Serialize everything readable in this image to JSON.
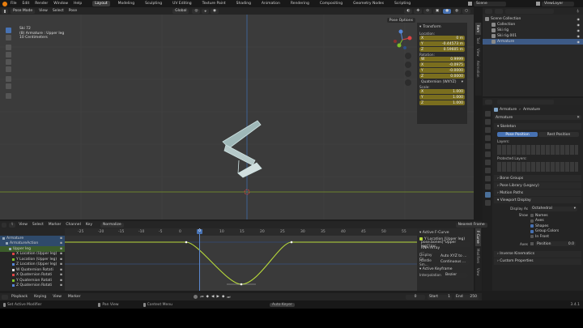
{
  "topbar": {
    "menus": [
      "File",
      "Edit",
      "Render",
      "Window",
      "Help"
    ],
    "tabs": [
      "Layout",
      "Modeling",
      "Sculpting",
      "UV Editing",
      "Texture Paint",
      "Shading",
      "Animation",
      "Rendering",
      "Compositing",
      "Geometry Nodes",
      "Scripting"
    ],
    "active_tab": "Layout",
    "scene": "Scene",
    "view_layer": "ViewLayer"
  },
  "viewport": {
    "mode": "Pose Mode",
    "menus": [
      "View",
      "Select",
      "Pose"
    ],
    "transform_orientation": "Global",
    "info_line1": "Ski 72",
    "info_line2": "(8) Armature : Upper leg",
    "info_line3": "10 Centimeters",
    "options_label": "Pose Options"
  },
  "npanel": {
    "title": "Transform",
    "location_label": "Location:",
    "location": [
      [
        "X",
        "0 m"
      ],
      [
        "Y",
        "-0.44573 m"
      ],
      [
        "Z",
        "0.59605 m"
      ]
    ],
    "rotation_label": "Rotation:",
    "rotation": [
      [
        "W",
        "0.9999"
      ],
      [
        "X",
        "-0.0975"
      ],
      [
        "Y",
        "-0.0000"
      ],
      [
        "Z",
        "0.0000"
      ]
    ],
    "rotation_mode": "Quaternion (WXYZ)",
    "scale_label": "Scale:",
    "scale": [
      [
        "X",
        "1.000"
      ],
      [
        "Y",
        "1.000"
      ],
      [
        "Z",
        "1.000"
      ]
    ],
    "tabs": [
      "Item",
      "Tool",
      "View",
      "Animation"
    ]
  },
  "outliner": {
    "rows": [
      {
        "label": "Scene Collection",
        "indent": 0,
        "sel": false
      },
      {
        "label": "Collection",
        "indent": 1,
        "sel": false
      },
      {
        "label": "Ski rig",
        "indent": 1,
        "sel": false
      },
      {
        "label": "Ski rig.001",
        "indent": 1,
        "sel": false
      },
      {
        "label": "Armature",
        "indent": 1,
        "sel": true
      }
    ]
  },
  "properties": {
    "breadcrumb1": "Armature",
    "breadcrumb2": "Armature",
    "name_field": "Armature",
    "skeleton": "Skeleton",
    "pose_position": "Pose Position",
    "rest_position": "Rest Position",
    "layers": "Layers:",
    "protected_layers": "Protected Layers:",
    "bone_groups": "Bone Groups",
    "pose_library": "Pose Library (Legacy)",
    "motion_paths": "Motion Paths",
    "viewport_display": "Viewport Display",
    "display_as_label": "Display As",
    "display_as": "Octahedral",
    "show_label": "Show",
    "show_items": [
      "Names",
      "Axes",
      "Shapes",
      "Group Colors",
      "In Front"
    ],
    "show_checked": [
      false,
      false,
      true,
      true,
      false
    ],
    "axes_label": "Axes",
    "axes_pos_label": "Position",
    "axes_pos": "0.0",
    "inverse_kinematics": "Inverse Kinematics",
    "custom_properties": "Custom Properties"
  },
  "graph": {
    "menus": [
      "View",
      "Select",
      "Marker",
      "Channel",
      "Key"
    ],
    "normalize": "Normalize",
    "pivot": "Nearest Frame",
    "frame_ticks": [
      "-25",
      "-20",
      "-15",
      "-10",
      "-5",
      "0",
      "5",
      "10",
      "15",
      "20",
      "25",
      "30",
      "35",
      "40",
      "45",
      "50",
      "55"
    ],
    "current_frame": "0",
    "channels": [
      "Armature",
      "ArmatureAction",
      "Upper leg",
      "X Location (Upper leg)",
      "Y Location (Upper leg)",
      "Z Location (Upper leg)",
      "W Quaternion Rotati",
      "X Quaternion Rotati",
      "Y Quaternion Rotati",
      "Z Quaternion Rotati"
    ],
    "fcurve_panel": "Active F-Curve",
    "fcurve_name": "Y Location (Upper leg)",
    "fcurve_path": "pose.bones[\"Upper leg\"].loc",
    "rna_array": "RNA Array ...",
    "display_color_label": "Display Co...",
    "display_color": "Auto XYZ to ...",
    "handle_smoothing_label": "Handle Sm...",
    "handle_smoothing": "Continuous ...",
    "active_keyframe": "Active Keyframe",
    "interpolation_label": "Interpolation",
    "interpolation": "Bezier",
    "side_tabs": [
      "F-Curve",
      "Modifiers",
      "View"
    ]
  },
  "timeline": {
    "playback": "Playback",
    "keying": "Keying",
    "view": "View",
    "marker": "Marker",
    "current": "0",
    "start_label": "Start",
    "start": "1",
    "end_label": "End",
    "end": "250"
  },
  "status": {
    "select": "Set Active Modifier",
    "pan": "Pan View",
    "context": "Context Menu",
    "auto": "Auto Keyer",
    "version": "3.4.1"
  }
}
